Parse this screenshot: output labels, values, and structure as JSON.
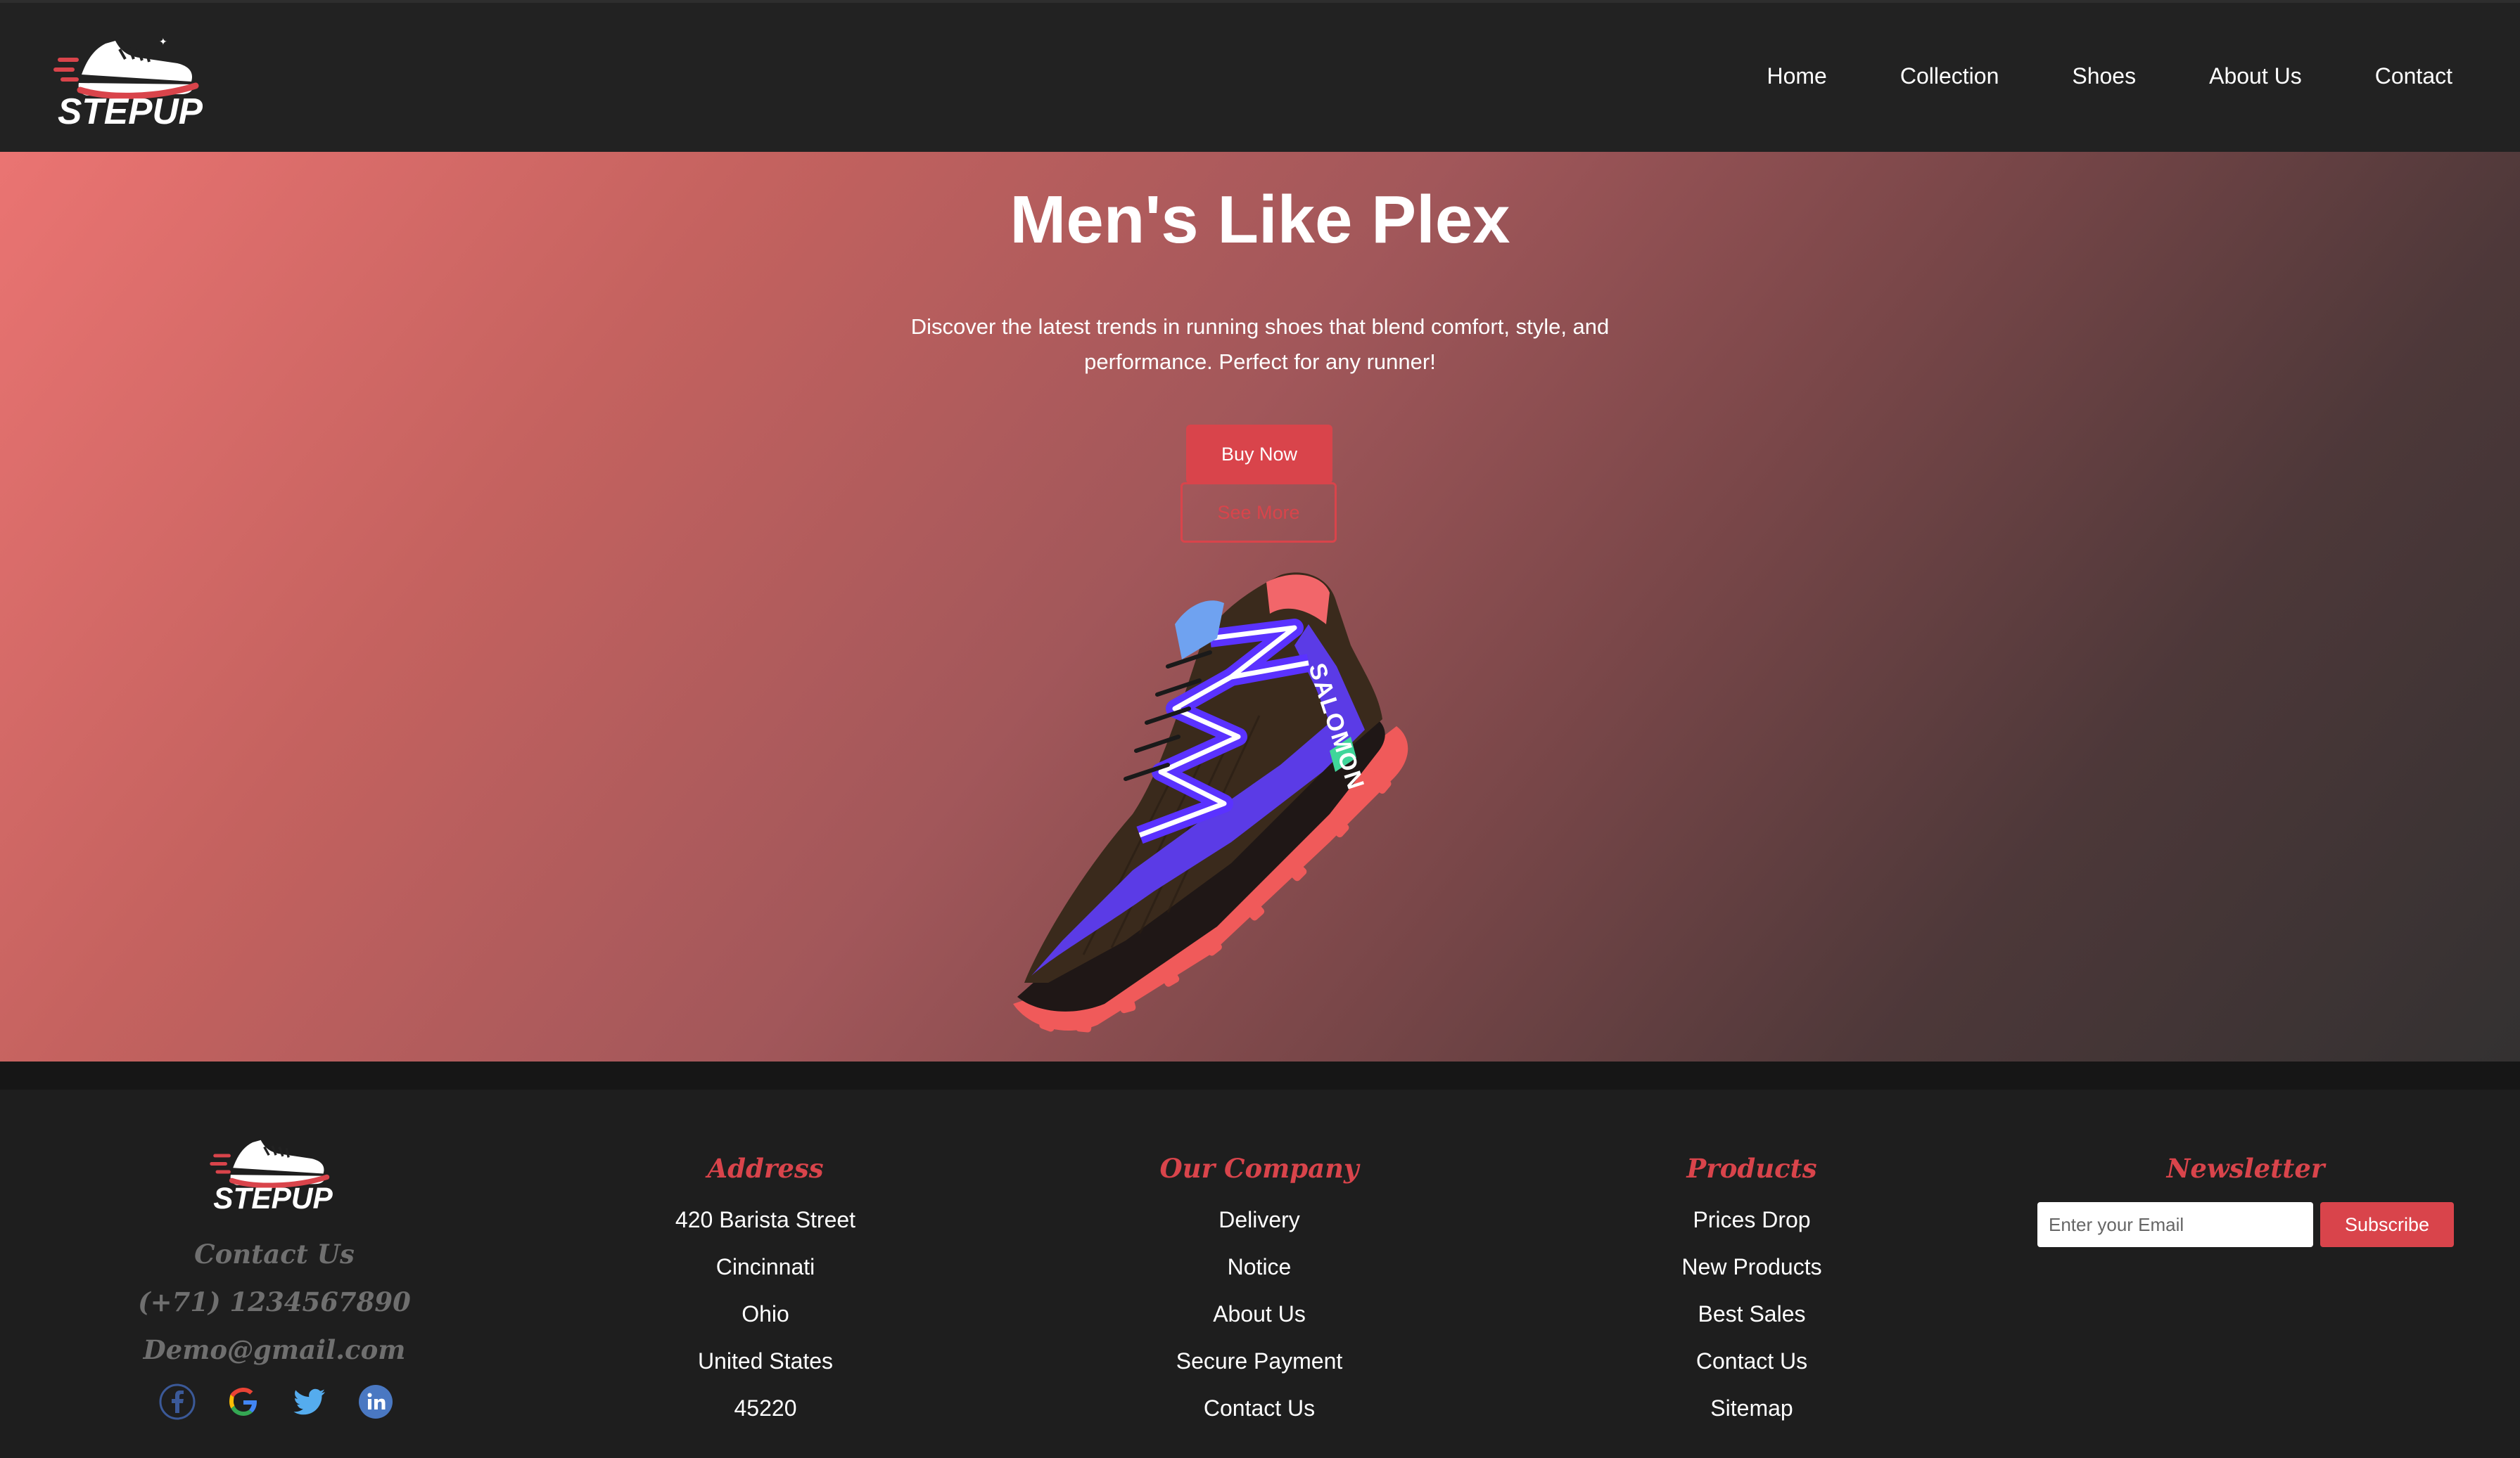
{
  "brand": {
    "name": "STEPUP",
    "accent_color": "#d9444b"
  },
  "nav": {
    "items": [
      {
        "label": "Home"
      },
      {
        "label": "Collection"
      },
      {
        "label": "Shoes"
      },
      {
        "label": "About Us"
      },
      {
        "label": "Contact"
      }
    ]
  },
  "hero": {
    "title": "Men's Like Plex",
    "description": "Discover the latest trends in running shoes that blend comfort, style, and performance. Perfect for any runner!",
    "buy_label": "Buy Now",
    "more_label": "See More",
    "product_image": "running-shoe-image",
    "shoe_brand_text": "SALOMON"
  },
  "footer": {
    "contact": {
      "title": "Contact Us",
      "phone": "(+71) 1234567890",
      "email": "Demo@gmail.com"
    },
    "social_icons": [
      "facebook-icon",
      "google-icon",
      "twitter-icon",
      "linkedin-icon"
    ],
    "address": {
      "title": "Address",
      "lines": [
        "420 Barista Street",
        "Cincinnati",
        "Ohio",
        "United States",
        "45220"
      ]
    },
    "company": {
      "title": "Our Company",
      "links": [
        "Delivery",
        "Notice",
        "About Us",
        "Secure Payment",
        "Contact Us"
      ]
    },
    "products": {
      "title": "Products",
      "links": [
        "Prices Drop",
        "New Products",
        "Best Sales",
        "Contact Us",
        "Sitemap"
      ]
    },
    "newsletter": {
      "title": "Newsletter",
      "placeholder": "Enter your Email",
      "value": "",
      "button_label": "Subscribe"
    }
  }
}
